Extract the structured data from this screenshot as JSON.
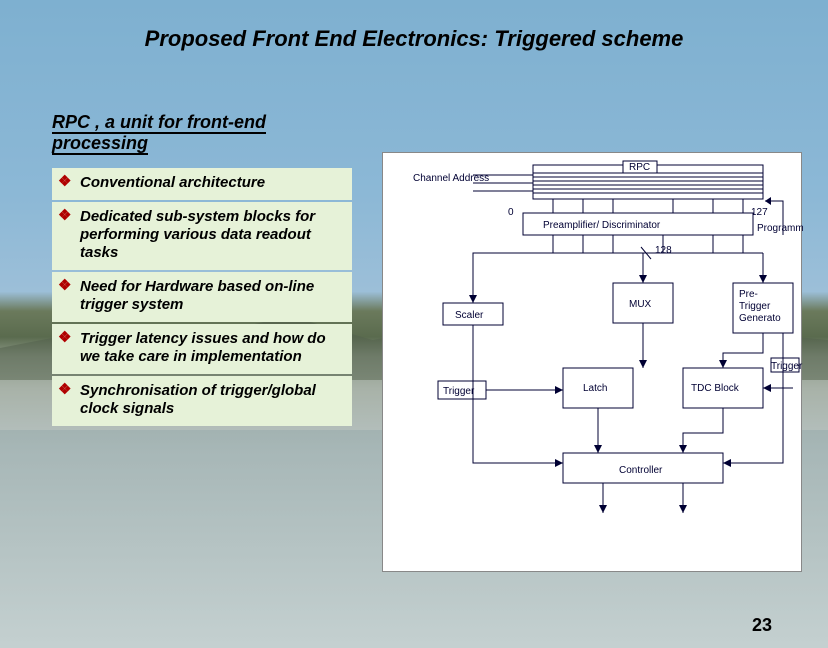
{
  "title": "Proposed Front End Electronics: Triggered scheme",
  "subtitle_line1": "RPC , a unit for front-end",
  "subtitle_line2": "processing",
  "bullets": [
    "Conventional architecture",
    "Dedicated sub-system blocks for performing various data readout tasks",
    "Need for Hardware based on-line trigger system",
    "Trigger latency issues and how do we take care in implementation",
    "Synchronisation of trigger/global clock signals"
  ],
  "diagram": {
    "channel_address": "Channel\nAddress",
    "rpc": "RPC",
    "preamp": "Preamplifier/ Discriminator",
    "idx_left": "0",
    "idx_right": "127",
    "programmable": "Programmable",
    "count128": "128",
    "scaler": "Scaler",
    "mux": "MUX",
    "pretrigger": "Pre-\nTrigger\nGenerato",
    "latch": "Latch",
    "tdc": "TDC Block",
    "trigger_label": "Trigger",
    "controller": "Controller"
  },
  "page_number": "23"
}
